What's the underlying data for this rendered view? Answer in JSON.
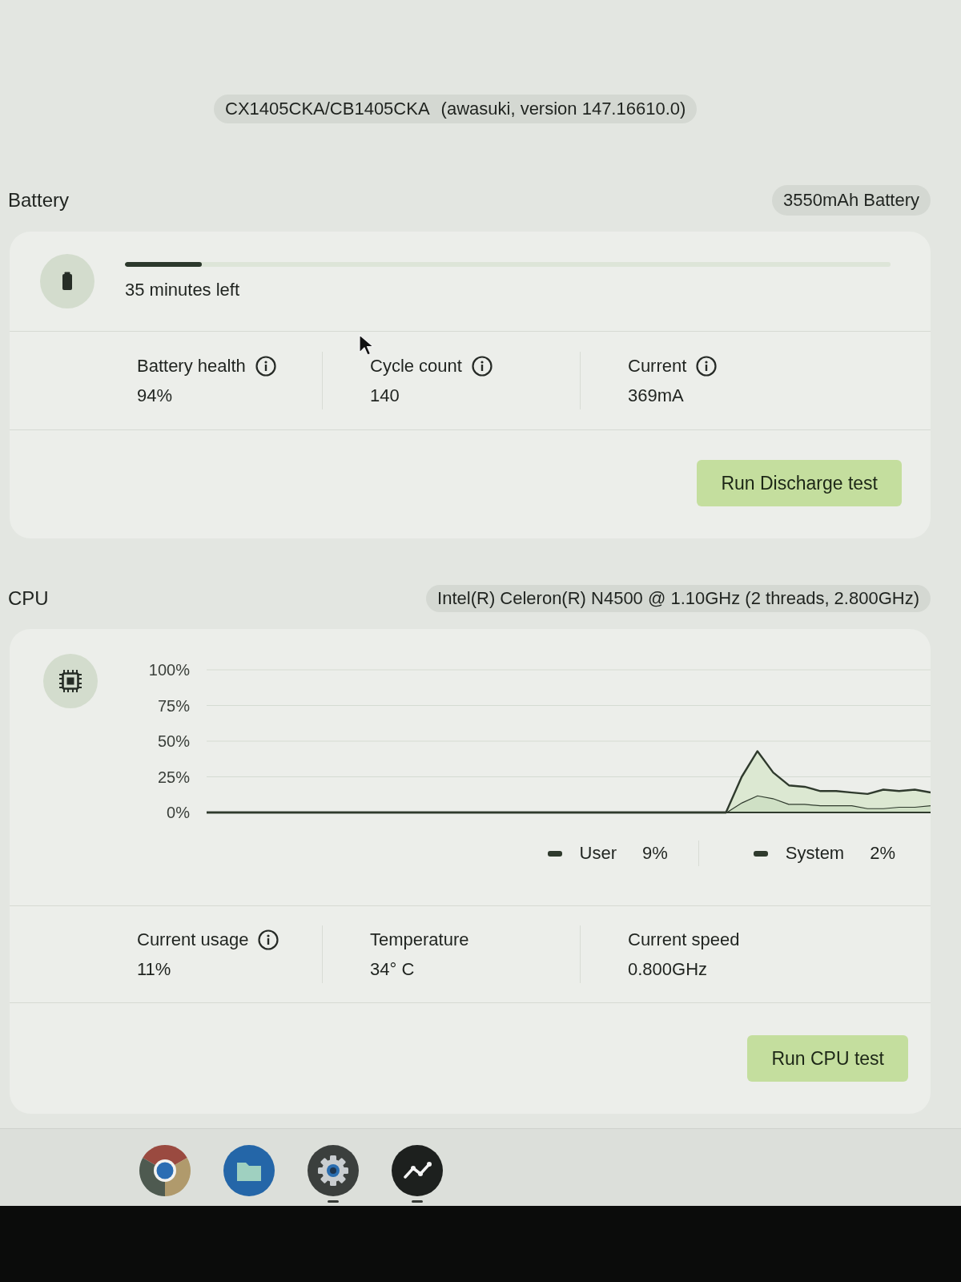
{
  "header": {
    "device": "CX1405CKA/CB1405CKA",
    "version": "(awasuki, version 147.16610.0)"
  },
  "battery": {
    "title": "Battery",
    "badge": "3550mAh Battery",
    "charge": {
      "level": 0.1,
      "label": "35 minutes left"
    },
    "stats": [
      {
        "label": "Battery health",
        "info": true,
        "value": "94%"
      },
      {
        "label": "Cycle count",
        "info": true,
        "value": "140"
      },
      {
        "label": "Current",
        "info": true,
        "value": "369mA"
      }
    ],
    "button": "Run Discharge test"
  },
  "cpu": {
    "title": "CPU",
    "badge": "Intel(R) Celeron(R) N4500 @ 1.10GHz (2 threads, 2.800GHz)",
    "chart_data": {
      "type": "area",
      "stacked": true,
      "grid": true,
      "ylim": [
        0,
        100
      ],
      "yticks": [
        {
          "value": 0,
          "label": "0%"
        },
        {
          "value": 25,
          "label": "25%"
        },
        {
          "value": 50,
          "label": "50%"
        },
        {
          "value": 75,
          "label": "75%"
        },
        {
          "value": 100,
          "label": "100%"
        }
      ],
      "series": [
        {
          "name": "User",
          "values": [
            0,
            0,
            0,
            0,
            0,
            0,
            0,
            0,
            0,
            0,
            0,
            0,
            0,
            0,
            0,
            0,
            0,
            0,
            0,
            0,
            0,
            0,
            0,
            0,
            0,
            0,
            0,
            0,
            0,
            0,
            0,
            0,
            0,
            0,
            7,
            12,
            10,
            6,
            6,
            5,
            5,
            5,
            3,
            3,
            4,
            4,
            5
          ]
        },
        {
          "name": "System",
          "values": [
            0,
            0,
            0,
            0,
            0,
            0,
            0,
            0,
            0,
            0,
            0,
            0,
            0,
            0,
            0,
            0,
            0,
            0,
            0,
            0,
            0,
            0,
            0,
            0,
            0,
            0,
            0,
            0,
            0,
            0,
            0,
            0,
            0,
            0,
            18,
            31,
            18,
            13,
            12,
            10,
            10,
            9,
            10,
            13,
            11,
            12,
            9
          ]
        }
      ]
    },
    "legend_values": [
      "9%",
      "2%"
    ],
    "stats": [
      {
        "label": "Current usage",
        "info": true,
        "value": "11%"
      },
      {
        "label": "Temperature",
        "info": false,
        "value": "34° C"
      },
      {
        "label": "Current speed",
        "info": false,
        "value": "0.800GHz"
      }
    ],
    "button": "Run CPU test"
  },
  "shelf": {
    "apps": [
      {
        "kind": "browser",
        "running": false
      },
      {
        "kind": "files",
        "running": false
      },
      {
        "kind": "settings",
        "running": true
      },
      {
        "kind": "diagnostics",
        "running": true
      }
    ]
  }
}
